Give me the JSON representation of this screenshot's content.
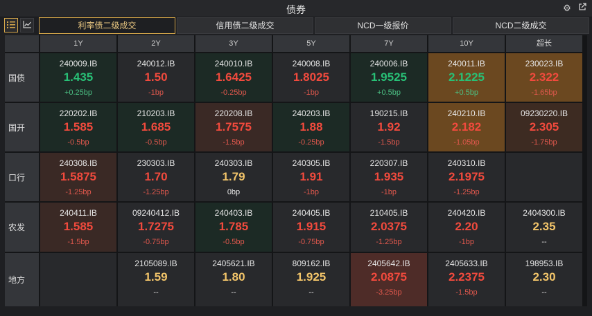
{
  "window": {
    "title": "债券"
  },
  "toolbar": {
    "tabs": [
      {
        "label": "利率债二级成交"
      },
      {
        "label": "信用债二级成交"
      },
      {
        "label": "NCD一级报价"
      },
      {
        "label": "NCD二级成交"
      }
    ]
  },
  "grid": {
    "columns": [
      "1Y",
      "2Y",
      "3Y",
      "5Y",
      "7Y",
      "10Y",
      "超长"
    ],
    "rows": [
      {
        "label": "国债",
        "cells": [
          {
            "code": "240009.IB",
            "yield": "1.435",
            "change": "+0.25bp"
          },
          {
            "code": "240012.IB",
            "yield": "1.50",
            "change": "-1bp"
          },
          {
            "code": "240010.IB",
            "yield": "1.6425",
            "change": "-0.25bp"
          },
          {
            "code": "240008.IB",
            "yield": "1.8025",
            "change": "-1bp"
          },
          {
            "code": "240006.IB",
            "yield": "1.9525",
            "change": "+0.5bp"
          },
          {
            "code": "240011.IB",
            "yield": "2.1225",
            "change": "+0.5bp"
          },
          {
            "code": "230023.IB",
            "yield": "2.322",
            "change": "-1.65bp"
          }
        ]
      },
      {
        "label": "国开",
        "cells": [
          {
            "code": "220202.IB",
            "yield": "1.585",
            "change": "-0.5bp"
          },
          {
            "code": "210203.IB",
            "yield": "1.685",
            "change": "-0.5bp"
          },
          {
            "code": "220208.IB",
            "yield": "1.7575",
            "change": "-1.5bp"
          },
          {
            "code": "240203.IB",
            "yield": "1.88",
            "change": "-0.25bp"
          },
          {
            "code": "190215.IB",
            "yield": "1.92",
            "change": "-1.5bp"
          },
          {
            "code": "240210.IB",
            "yield": "2.182",
            "change": "-1.05bp"
          },
          {
            "code": "09230220.IB",
            "yield": "2.305",
            "change": "-1.75bp"
          }
        ]
      },
      {
        "label": "口行",
        "cells": [
          {
            "code": "240308.IB",
            "yield": "1.5875",
            "change": "-1.25bp"
          },
          {
            "code": "230303.IB",
            "yield": "1.70",
            "change": "-1.25bp"
          },
          {
            "code": "240303.IB",
            "yield": "1.79",
            "change": "0bp"
          },
          {
            "code": "240305.IB",
            "yield": "1.91",
            "change": "-1bp"
          },
          {
            "code": "220307.IB",
            "yield": "1.935",
            "change": "-1bp"
          },
          {
            "code": "240310.IB",
            "yield": "2.1975",
            "change": "-1.25bp"
          },
          {
            "code": "",
            "yield": "",
            "change": ""
          }
        ]
      },
      {
        "label": "农发",
        "cells": [
          {
            "code": "240411.IB",
            "yield": "1.585",
            "change": "-1.5bp"
          },
          {
            "code": "09240412.IB",
            "yield": "1.7275",
            "change": "-0.75bp"
          },
          {
            "code": "240403.IB",
            "yield": "1.785",
            "change": "-0.5bp"
          },
          {
            "code": "240405.IB",
            "yield": "1.915",
            "change": "-0.75bp"
          },
          {
            "code": "210405.IB",
            "yield": "2.0375",
            "change": "-1.25bp"
          },
          {
            "code": "240420.IB",
            "yield": "2.20",
            "change": "-1bp"
          },
          {
            "code": "2404300.IB",
            "yield": "2.35",
            "change": "--"
          }
        ]
      },
      {
        "label": "地方",
        "cells": [
          {
            "code": "",
            "yield": "",
            "change": ""
          },
          {
            "code": "2105089.IB",
            "yield": "1.59",
            "change": "--"
          },
          {
            "code": "2405621.IB",
            "yield": "1.80",
            "change": "--"
          },
          {
            "code": "809162.IB",
            "yield": "1.925",
            "change": "--"
          },
          {
            "code": "2405642.IB",
            "yield": "2.0875",
            "change": "-3.25bp"
          },
          {
            "code": "2405633.IB",
            "yield": "2.2375",
            "change": "-1.5bp"
          },
          {
            "code": "198953.IB",
            "yield": "2.30",
            "change": "--"
          }
        ]
      }
    ]
  },
  "colors": {
    "accent": "#d4a64a",
    "down": "#f24a3d",
    "up": "#28c076",
    "neutral": "#f3c56a"
  }
}
